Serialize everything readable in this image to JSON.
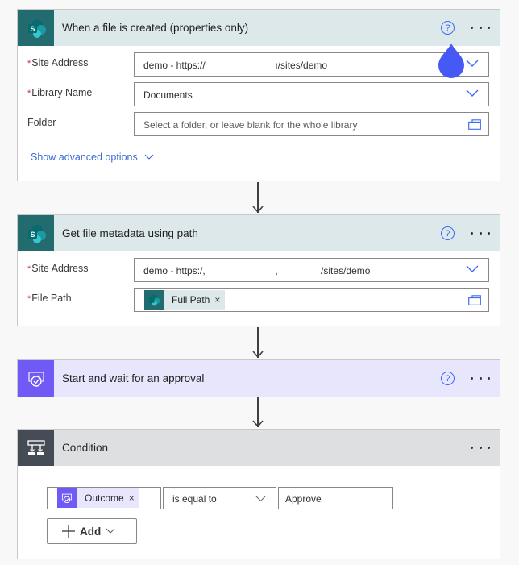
{
  "steps": [
    {
      "title": "When a file is created (properties only)",
      "icon": "sharepoint-icon",
      "fields": [
        {
          "label": "Site Address",
          "required": true,
          "value": "demo - https://                          ı/sites/demo",
          "control": "dropdown"
        },
        {
          "label": "Library Name",
          "required": true,
          "value": "Documents",
          "control": "dropdown"
        },
        {
          "label": "Folder",
          "required": false,
          "placeholder": "Select a folder, or leave blank for the whole library",
          "control": "folder-picker"
        }
      ],
      "advanced_link": "Show advanced options"
    },
    {
      "title": "Get file metadata using path",
      "icon": "sharepoint-icon",
      "fields": [
        {
          "label": "Site Address",
          "required": true,
          "value": "demo - https:/,                          ,                /sites/demo",
          "control": "dropdown"
        },
        {
          "label": "File Path",
          "required": true,
          "token": "Full Path",
          "control": "folder-picker"
        }
      ]
    },
    {
      "title": "Start and wait for an approval",
      "icon": "approval-icon"
    },
    {
      "title": "Condition",
      "icon": "condition-icon",
      "condition": {
        "left_token": "Outcome",
        "operator": "is equal to",
        "right_value": "Approve"
      },
      "add_label": "Add"
    }
  ],
  "required_marker": "*",
  "help_glyph": "?",
  "remove_glyph": "×",
  "colors": {
    "sharepoint_header": "#dce8ea",
    "sharepoint_icon": "#226c6f",
    "approval_header": "#e8e6fd",
    "approval_icon": "#705af5",
    "condition_header": "#dedfe0",
    "condition_icon": "#464c56",
    "accent": "#3d6bf5",
    "link": "#3a6bd6"
  }
}
